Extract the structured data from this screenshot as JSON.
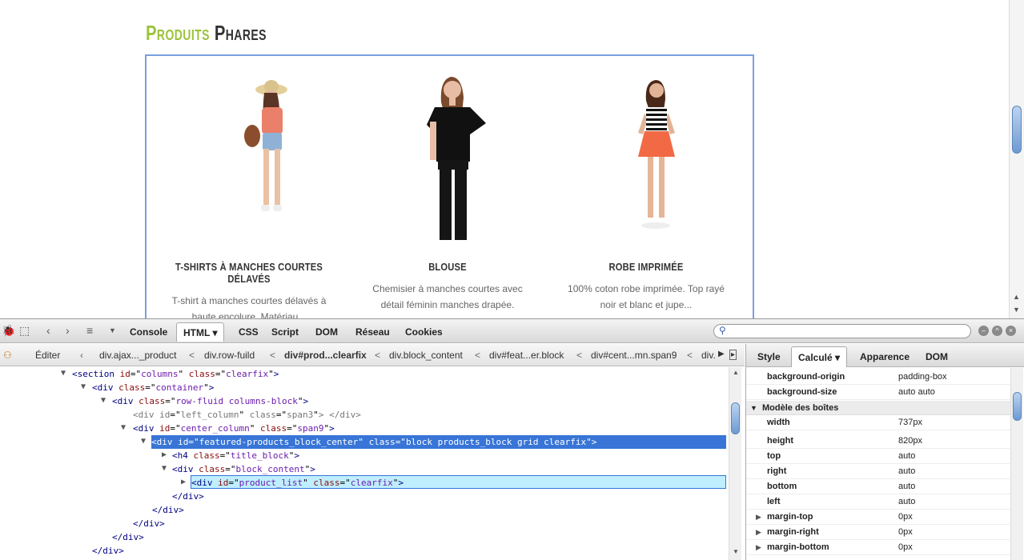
{
  "page": {
    "heading_a": "Produits",
    "heading_b": "Phares",
    "products": [
      {
        "name": "T-SHIRTS À MANCHES COURTES DÉLAVÉS",
        "desc_1": "T-shirt à manches courtes délavés à",
        "desc_2": "haute encolure. Matériau..."
      },
      {
        "name": "BLOUSE",
        "desc_1": "Chemisier à manches courtes avec",
        "desc_2": "détail féminin manches drapée."
      },
      {
        "name": "ROBE IMPRIMÉE",
        "desc_1": "100% coton robe imprimée. Top rayé",
        "desc_2": "noir et blanc et jupe..."
      }
    ]
  },
  "firebug": {
    "tabs": [
      "Console",
      "HTML",
      "CSS",
      "Script",
      "DOM",
      "Réseau",
      "Cookies"
    ],
    "active_tab": "HTML",
    "search_placeholder": "",
    "edit_label": "Éditer",
    "breadcrumbs": [
      "div.ajax..._product",
      "div.row-fuild",
      "div#prod...clearfix",
      "div.block_content",
      "div#feat...er.block",
      "div#cent...mn.span9",
      "div."
    ],
    "side_tabs": [
      "Style",
      "Calculé",
      "Apparence",
      "DOM"
    ],
    "active_side_tab": "Calculé",
    "html_nodes": [
      {
        "open": "<section",
        "attrs": [
          [
            "id",
            "columns"
          ],
          [
            "class",
            "clearfix"
          ]
        ],
        "close": ">"
      },
      {
        "open": "<div",
        "attrs": [
          [
            "class",
            "container"
          ]
        ],
        "close": ">"
      },
      {
        "open": "<div",
        "attrs": [
          [
            "class",
            "row-fluid columns-block"
          ]
        ],
        "close": ">"
      },
      {
        "open": "<div",
        "attrs": [
          [
            "id",
            "left_column"
          ],
          [
            "class",
            "span3"
          ]
        ],
        "close": ">  </div>"
      },
      {
        "open": "<div",
        "attrs": [
          [
            "id",
            "center_column"
          ],
          [
            "class",
            "span9"
          ]
        ],
        "close": ">"
      },
      {
        "open": "<div",
        "attrs": [
          [
            "id",
            "featured-products_block_center"
          ],
          [
            "class",
            "block products_block grid clearfix"
          ]
        ],
        "close": ">"
      },
      {
        "open": "<h4",
        "attrs": [
          [
            "class",
            "title_block"
          ]
        ],
        "close": ">"
      },
      {
        "open": "<div",
        "attrs": [
          [
            "class",
            "block_content"
          ]
        ],
        "close": ">"
      },
      {
        "open": "<div",
        "attrs": [
          [
            "id",
            "product_list"
          ],
          [
            "class",
            "clearfix"
          ]
        ],
        "close": ">"
      },
      {
        "open": "</div>",
        "attrs": [],
        "close": ""
      },
      {
        "open": "</div>",
        "attrs": [],
        "close": ""
      },
      {
        "open": "</div>",
        "attrs": [],
        "close": ""
      },
      {
        "open": "</div>",
        "attrs": [],
        "close": ""
      },
      {
        "open": "</div>",
        "attrs": [],
        "close": ""
      }
    ],
    "computed": {
      "props_top": [
        {
          "k": "background-origin",
          "v": "padding-box"
        },
        {
          "k": "background-size",
          "v": "auto auto"
        }
      ],
      "section_title": "Modèle des boîtes",
      "box_props": [
        {
          "k": "width",
          "v": "737px"
        },
        {
          "k": "height",
          "v": "820px"
        },
        {
          "k": "top",
          "v": "auto"
        },
        {
          "k": "right",
          "v": "auto"
        },
        {
          "k": "bottom",
          "v": "auto"
        },
        {
          "k": "left",
          "v": "auto"
        }
      ],
      "expand_props": [
        {
          "k": "margin-top",
          "v": "0px"
        },
        {
          "k": "margin-right",
          "v": "0px"
        },
        {
          "k": "margin-bottom",
          "v": "0px"
        }
      ]
    }
  }
}
